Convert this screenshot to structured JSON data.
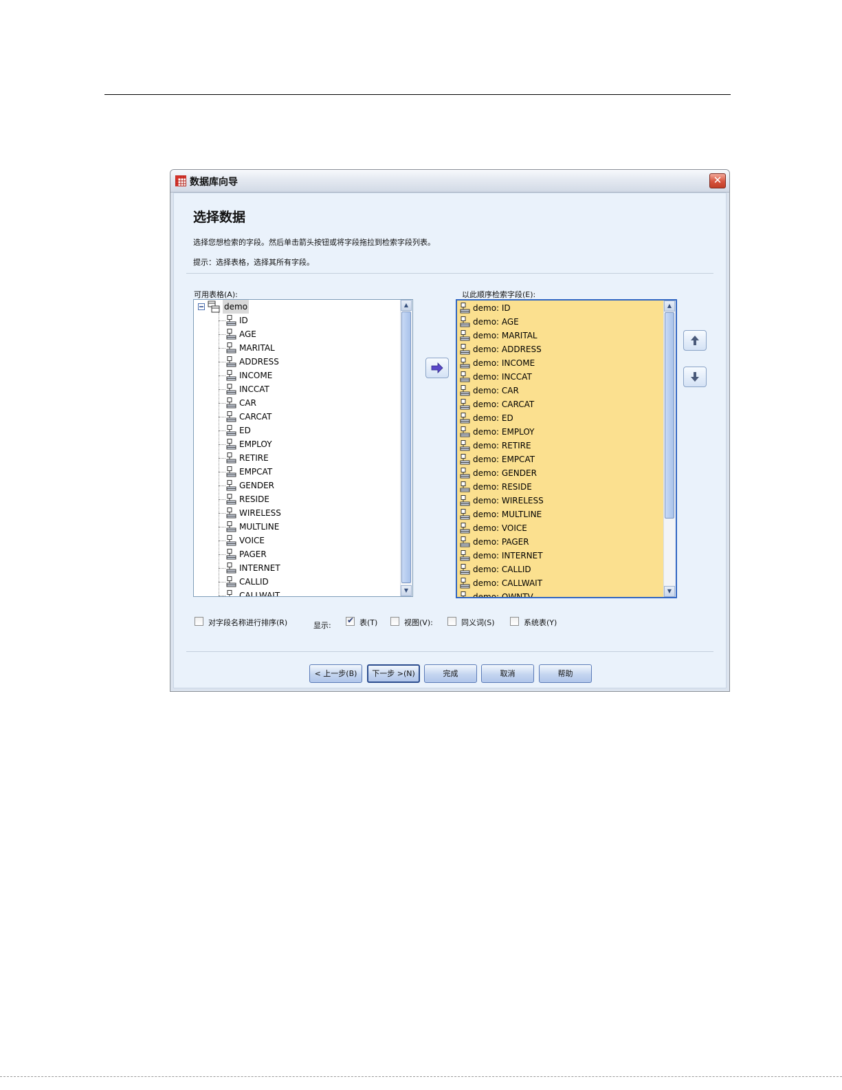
{
  "dialog": {
    "title": "数据库向导",
    "heading": "选择数据",
    "instruction": "选择您想检索的字段。然后单击箭头按钮或将字段拖拉到检索字段列表。",
    "tip": "提示：选择表格，选择其所有字段。"
  },
  "available": {
    "label": "可用表格(A):",
    "root": "demo",
    "fields": [
      "ID",
      "AGE",
      "MARITAL",
      "ADDRESS",
      "INCOME",
      "INCCAT",
      "CAR",
      "CARCAT",
      "ED",
      "EMPLOY",
      "RETIRE",
      "EMPCAT",
      "GENDER",
      "RESIDE",
      "WIRELESS",
      "MULTLINE",
      "VOICE",
      "PAGER",
      "INTERNET",
      "CALLID",
      "CALLWAIT"
    ]
  },
  "retrieve": {
    "label": "以此顺序检索字段(E):",
    "fields": [
      "demo: ID",
      "demo: AGE",
      "demo: MARITAL",
      "demo: ADDRESS",
      "demo: INCOME",
      "demo: INCCAT",
      "demo: CAR",
      "demo: CARCAT",
      "demo: ED",
      "demo: EMPLOY",
      "demo: RETIRE",
      "demo: EMPCAT",
      "demo: GENDER",
      "demo: RESIDE",
      "demo: WIRELESS",
      "demo: MULTLINE",
      "demo: VOICE",
      "demo: PAGER",
      "demo: INTERNET",
      "demo: CALLID",
      "demo: CALLWAIT",
      "demo: OWNTV"
    ]
  },
  "options": {
    "sort_label": "对字段名称进行排序(R)",
    "show_label": "显示:",
    "tables_label": "表(T)",
    "views_label": "视图(V):",
    "synonyms_label": "同义词(S)",
    "system_label": "系统表(Y)",
    "sort_checked": false,
    "tables_checked": true,
    "views_checked": false,
    "synonyms_checked": false,
    "system_checked": false
  },
  "buttons": {
    "back": "< 上一步(B)",
    "next": "下一步 >(N)",
    "finish": "完成",
    "cancel": "取消",
    "help": "帮助"
  },
  "colors": {
    "selected_list_bg": "#fbe08f",
    "dialog_bg": "#eaf2fb",
    "accent": "#3065c2"
  },
  "icons": {
    "app": "table-grid-icon",
    "field": "field-node-icon",
    "table": "table-node-icon",
    "move_right": "arrow-right-icon",
    "move_up": "arrow-up-icon",
    "move_down": "arrow-down-icon",
    "close": "close-icon"
  }
}
